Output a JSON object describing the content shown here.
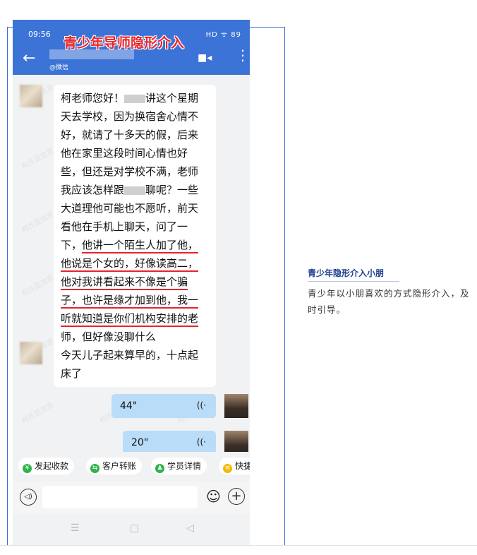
{
  "phone": {
    "status": {
      "time": "09:56",
      "icons": "HD ᯤ 89"
    },
    "overlay_title": "青少年导师隐形介入",
    "header": {
      "back": "←",
      "contact_sub": "@微信",
      "video": "■◂",
      "more": "⋮"
    },
    "messages": [
      {
        "from": "left",
        "lines": [
          {
            "pre": "柯老师您好！",
            "blur": true,
            "post": "讲这个星期",
            "ul": false
          },
          {
            "text": "天去学校，因为换宿舍心情不",
            "ul": false
          },
          {
            "text": "好，就请了十多天的假，后来",
            "ul": false
          },
          {
            "text": "他在家里这段时间心情也好",
            "ul": false
          },
          {
            "text": "些，但还是对学校不满，老师",
            "ul": false
          },
          {
            "pre": "我应该怎样跟",
            "blur": true,
            "post": "聊呢？一些",
            "ul": false
          },
          {
            "text": "大道理他可能也不愿听，前天",
            "ul": false
          },
          {
            "text": "看他在手机上聊天，问了一",
            "ul": false
          },
          {
            "pre": "下，",
            "text_ul": "他讲一个陌生人加了他，",
            "ul": "partial"
          },
          {
            "text": "他说是个女的，好像读高二，",
            "ul": true
          },
          {
            "text": "他对我讲看起来不像是个骗",
            "ul": true
          },
          {
            "text": "子，也许是缘才加到他，我一",
            "ul": true
          },
          {
            "text": "听就知道是你们机构安排的老",
            "ul": true
          },
          {
            "text": "师，但好像没聊什么",
            "ul": true
          }
        ]
      },
      {
        "from": "left",
        "lines": [
          {
            "text": "今天儿子起来算早的，十点起",
            "ul": false
          },
          {
            "text": "床了",
            "ul": false
          }
        ]
      }
    ],
    "voice_messages": [
      {
        "duration": "44\"",
        "wave": "((·"
      },
      {
        "duration": "20\"",
        "wave": "((·"
      }
    ],
    "quick_actions": [
      {
        "label": "发起收款",
        "icon": "¥",
        "color": "#2fb24a"
      },
      {
        "label": "客户转账",
        "icon": "⇆",
        "color": "#2fb24a"
      },
      {
        "label": "学员详情",
        "icon": "♟",
        "color": "#2fb24a"
      },
      {
        "label": "快捷",
        "icon": "≡",
        "color": "#f5b800"
      }
    ],
    "input": {
      "voice_icon": "◁)",
      "emoji": "☺",
      "plus": "+"
    },
    "nav": {
      "menu": "☰",
      "home": "▢",
      "back": "◁"
    },
    "watermark": "柯氏蓝信息"
  },
  "caption": {
    "title": "青少年隐形介入小朋",
    "text": "青少年以小朋喜欢的方式隐形介入，及时引导。"
  }
}
